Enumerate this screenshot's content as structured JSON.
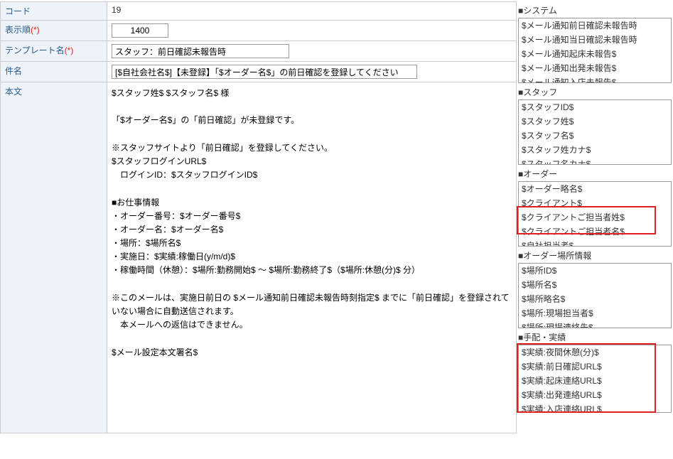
{
  "form": {
    "code_label": "コード",
    "code_value": "19",
    "order_label": "表示順",
    "order_required": "(*)",
    "order_value": "1400",
    "template_name_label": "テンプレート名",
    "template_name_required": "(*)",
    "template_name_value": "スタッフ：前日確認未報告時",
    "subject_label": "件名",
    "subject_value": "[$自社会社名$]【未登録】「$オーダー名$」の前日確認を登録してください",
    "body_label": "本文",
    "body_value": "$スタッフ姓$ $スタッフ名$ 様\n\n「$オーダー名$」の「前日確認」が未登録です。\n\n※スタッフサイトより「前日確認」を登録してください。\n$スタッフログインURL$\n　ログインID：$スタッフログインID$\n\n■お仕事情報\n・オーダー番号：$オーダー番号$\n・オーダー名：$オーダー名$\n・場所：$場所名$\n・実施日：$実績:稼働日(y/m/d)$\n・稼働時間（休憩）：$場所:勤務開始$ ～ $場所:勤務終了$（$場所:休憩(分)$ 分）\n\n※このメールは、実施日前日の $メール通知前日確認未報告時刻指定$ までに「前日確認」を登録されていない場合に自動送信されます。\n　本メールへの返信はできません。\n\n$メール設定本文署名$"
  },
  "sections": {
    "system": {
      "title": "■システム",
      "items": [
        "$メール通知前日確認未報告時",
        "$メール通知当日確認未報告時",
        "$メール通知起床未報告$",
        "$メール通知出発未報告$",
        "$メール通知入店未報告$"
      ]
    },
    "staff": {
      "title": "■スタッフ",
      "items": [
        "$スタッフID$",
        "$スタッフ姓$",
        "$スタッフ名$",
        "$スタッフ姓カナ$",
        "$スタッフ名カナ$"
      ]
    },
    "order": {
      "title": "■オーダー",
      "items": [
        "$オーダー略名$",
        "$クライアント$",
        "$クライアントご担当者姓$",
        "$クライアントご担当者名$",
        "$自社担当者$"
      ]
    },
    "order_location": {
      "title": "■オーダー場所情報",
      "items": [
        "$場所ID$",
        "$場所名$",
        "$場所略名$",
        "$場所:現場担当者$",
        "$場所:現場連絡先$"
      ]
    },
    "results": {
      "title": "■手配・実績",
      "items": [
        "$実績:夜間休憩(分)$",
        "$実績:前日確認URL$",
        "$実績:起床連絡URL$",
        "$実績:出発連絡URL$",
        "$実績:入店連絡URL$"
      ]
    }
  }
}
